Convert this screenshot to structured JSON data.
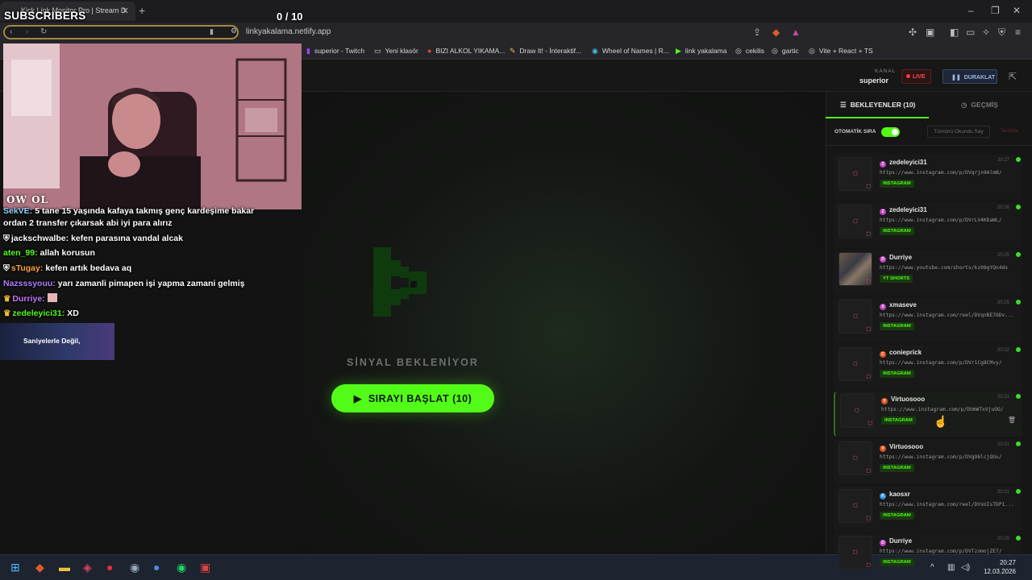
{
  "browser": {
    "tab_title": "Kick Link Monitor Pro | Stream D",
    "url": "linkyakalama.netlify.app",
    "bookmarks": [
      {
        "label": "superior - Twitch",
        "icon": "twitch-icon"
      },
      {
        "label": "Yeni klasör",
        "icon": "folder-icon"
      },
      {
        "label": "BIZI ALKOL YIKAMA...",
        "icon": "site-icon"
      },
      {
        "label": "Draw It! - İnteraktif...",
        "icon": "site-icon"
      },
      {
        "label": "Wheel of Names | R...",
        "icon": "site-icon"
      },
      {
        "label": "link yakalama",
        "icon": "kick-icon"
      },
      {
        "label": "cekilis",
        "icon": "globe-icon"
      },
      {
        "label": "gartic",
        "icon": "globe-icon"
      },
      {
        "label": "Vite + React + TS",
        "icon": "globe-icon"
      }
    ]
  },
  "app": {
    "kanal_label": "KANAL",
    "kanal_value": "superior",
    "live_label": "LIVE",
    "pause_label": "DURAKLAT",
    "status_text": "SİNYAL BEKLENİYOR",
    "start_button": "SIRAYI BAŞLAT (10)",
    "accent": "#53fc18"
  },
  "panel": {
    "tab_waiting": "BEKLEYENLER (10)",
    "tab_history": "GEÇMİŞ",
    "auto_queue_label": "OTOMATİK SIRA",
    "auto_queue_on": true,
    "mark_all_read": "Tümünü Okundu Say",
    "clear": "Temizle",
    "items": [
      {
        "user": "zedeleyici31",
        "link": "https://www.instagram.com/p/DVqrjn9AlmB/",
        "tag": "INSTAGRAM",
        "time": "20:27",
        "avatar_color": "#c040c0",
        "avatar_letter": "Z",
        "thumb": "instagram"
      },
      {
        "user": "zedeleyici31",
        "link": "https://www.instagram.com/p/DVrLV4KDaWL/",
        "tag": "INSTAGRAM",
        "time": "20:26",
        "avatar_color": "#c040c0",
        "avatar_letter": "Z",
        "thumb": "instagram"
      },
      {
        "user": "Durriye",
        "link": "https://www.youtube.com/shorts/kz08gYQn4ds",
        "tag": "YT SHORTS",
        "time": "20:25",
        "avatar_color": "#c040c0",
        "avatar_letter": "D",
        "thumb": "image"
      },
      {
        "user": "xmaseve",
        "link": "https://www.instagram.com/reel/DVqnBE7ODv...",
        "tag": "INSTAGRAM",
        "time": "20:25",
        "avatar_color": "#c040c0",
        "avatar_letter": "X",
        "thumb": "instagram"
      },
      {
        "user": "conieprick",
        "link": "https://www.instagram.com/p/DVr1Cg8CMvy/",
        "tag": "INSTAGRAM",
        "time": "20:22",
        "avatar_color": "#e05020",
        "avatar_letter": "C",
        "thumb": "instagram"
      },
      {
        "user": "Virtuosooo",
        "link": "https://www.instagram.com/p/DUmWTxVjuOO/",
        "tag": "INSTAGRAM",
        "time": "20:21",
        "avatar_color": "#e05020",
        "avatar_letter": "V",
        "thumb": "instagram",
        "selected": true
      },
      {
        "user": "Virtuosooo",
        "link": "https://www.instagram.com/p/DVgO6lcjQUu/",
        "tag": "INSTAGRAM",
        "time": "20:21",
        "avatar_color": "#e05020",
        "avatar_letter": "V",
        "thumb": "instagram"
      },
      {
        "user": "kaosxr",
        "link": "https://www.instagram.com/reel/DVsUIsTDP1...",
        "tag": "INSTAGRAM",
        "time": "20:21",
        "avatar_color": "#3090e0",
        "avatar_letter": "K",
        "thumb": "instagram"
      },
      {
        "user": "Durriye",
        "link": "https://www.instagram.com/p/DVTzomojZE7/",
        "tag": "INSTAGRAM",
        "time": "20:20",
        "avatar_color": "#c040c0",
        "avatar_letter": "D",
        "thumb": "instagram"
      }
    ]
  },
  "overlay": {
    "subscribers_label": "SUBSCRIBERS",
    "subscribers_count": "0  / 10",
    "brand": "OW OL",
    "promo_text": "Saniyelerle Değil,",
    "chat": [
      {
        "name": "SekVE:",
        "name_color": "#8fd3ff",
        "text": "5 tane 15 yaşında kafaya takmış genç kardeşime bakar"
      },
      {
        "name": "",
        "name_color": "#ffffff",
        "text": "ordan 2 transfer çıkarsak abi iyi para alırız"
      },
      {
        "name": "jackschwalbe:",
        "name_color": "#ffffff",
        "text": "kefen parasına vandal alcak"
      },
      {
        "name": "aten_99:",
        "name_color": "#53fc18",
        "text": "allah korusun"
      },
      {
        "name": "sTugay:",
        "name_color": "#ffa13a",
        "text": "kefen artık bedava aq"
      },
      {
        "name": "Nazsssyouu:",
        "name_color": "#b37cff",
        "text": "yarı zamanli pimapen işi yapma zamani gelmiş"
      },
      {
        "name": "Durriye:",
        "name_color": "#c878ff",
        "text": ""
      },
      {
        "name": "zedeleyici31:",
        "name_color": "#53fc18",
        "text": "XD"
      }
    ]
  },
  "taskbar": {
    "time": "20:27",
    "date": "12.03.2026"
  }
}
